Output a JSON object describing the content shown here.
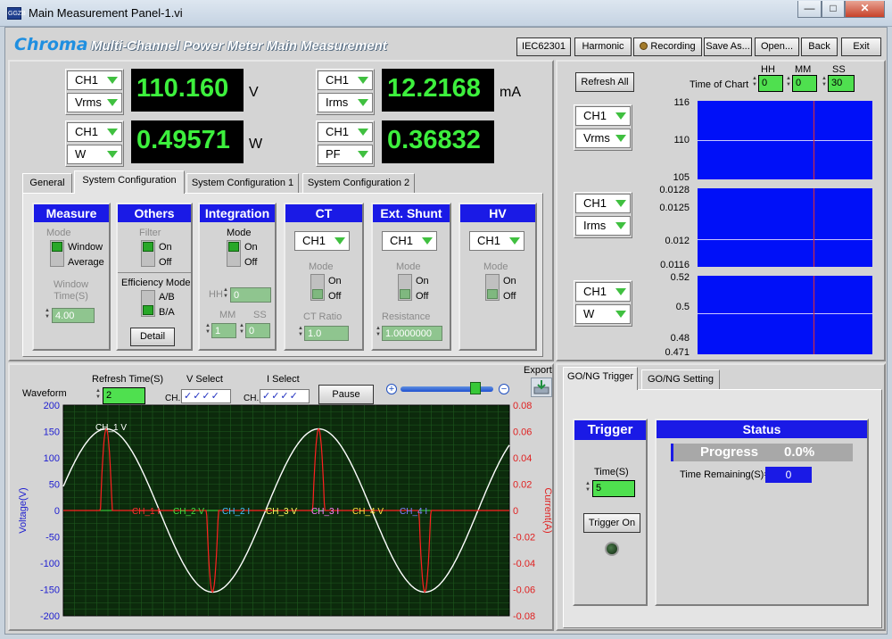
{
  "window": {
    "title": "Main Measurement Panel-1.vi",
    "icon_text": "GGZB",
    "minimize": "—",
    "maximize": "□",
    "close": "✕"
  },
  "header": {
    "logo": "Chroma",
    "title": "Multi-Channel Power Meter Main Measurement",
    "buttons": [
      "IEC62301",
      "Harmonic",
      "Recording",
      "Save As...",
      "Open...",
      "Back",
      "Exit"
    ]
  },
  "measurements": [
    {
      "channel": "CH1",
      "param": "Vrms",
      "value": "110.160",
      "unit": "V"
    },
    {
      "channel": "CH1",
      "param": "Irms",
      "value": "12.2168",
      "unit": "mA"
    },
    {
      "channel": "CH1",
      "param": "W",
      "value": "0.49571",
      "unit": "W"
    },
    {
      "channel": "CH1",
      "param": "PF",
      "value": "0.36832",
      "unit": ""
    }
  ],
  "tabs": [
    "General",
    "System Configuration",
    "System Configuration 1",
    "System Configuration 2"
  ],
  "active_tab": "System Configuration",
  "config": {
    "measure": {
      "title": "Measure",
      "mode_label": "Mode",
      "opt1": "Window",
      "opt2": "Average",
      "time_label": "Window\nTime(S)",
      "time_value": "4.00"
    },
    "others": {
      "title": "Others",
      "filter_label": "Filter",
      "on": "On",
      "off": "Off",
      "eff_label": "Efficiency Mode",
      "ab": "A/B",
      "ba": "B/A",
      "detail": "Detail"
    },
    "integration": {
      "title": "Integration",
      "mode_label": "Mode",
      "on": "On",
      "off": "Off",
      "hh_label": "HH",
      "hh_value": "0",
      "mm_label": "MM",
      "mm_value": "1",
      "ss_label": "SS",
      "ss_value": "0"
    },
    "ct": {
      "title": "CT",
      "channel": "CH1",
      "mode_label": "Mode",
      "on": "On",
      "off": "Off",
      "ratio_label": "CT Ratio",
      "ratio_value": "1.0"
    },
    "ext_shunt": {
      "title": "Ext. Shunt",
      "channel": "CH1",
      "mode_label": "Mode",
      "on": "On",
      "off": "Off",
      "res_label": "Resistance",
      "res_value": "1.0000000"
    },
    "hv": {
      "title": "HV",
      "channel": "CH1",
      "mode_label": "Mode",
      "on": "On",
      "off": "Off"
    }
  },
  "trend": {
    "refresh_all": "Refresh All",
    "time_of_chart_label": "Time of Chart",
    "hh_label": "HH",
    "hh_value": "0",
    "mm_label": "MM",
    "mm_value": "0",
    "ss_label": "SS",
    "ss_value": "30",
    "charts": [
      {
        "channel": "CH1",
        "param": "Vrms",
        "ticks": [
          "116",
          "110",
          "105"
        ],
        "ymin": 105,
        "ymax": 116
      },
      {
        "channel": "CH1",
        "param": "Irms",
        "ticks": [
          "0.0128",
          "0.0125",
          "0.012",
          "0.0116"
        ],
        "ymin": 0.0116,
        "ymax": 0.0128
      },
      {
        "channel": "CH1",
        "param": "W",
        "ticks": [
          "0.52",
          "0.5",
          "0.48",
          "0.471"
        ],
        "ymin": 0.471,
        "ymax": 0.52
      }
    ]
  },
  "waveform": {
    "label": "Waveform",
    "refresh_label": "Refresh Time(S)",
    "refresh_value": "2",
    "vselect_label": "V Select",
    "iselect_label": "I Select",
    "ch_label": "CH.",
    "pause": "Pause",
    "export": "Export",
    "slider_value": 0.85
  },
  "chart_data": {
    "type": "line",
    "ylabel": "Voltage(V)",
    "y2label": "Current(A)",
    "ylim": [
      -200,
      200
    ],
    "y2lim": [
      -0.08,
      0.08
    ],
    "yticks": [
      "200",
      "150",
      "100",
      "50",
      "0",
      "-50",
      "-100",
      "-150",
      "-200"
    ],
    "y2ticks": [
      "0.08",
      "0.06",
      "0.04",
      "0.02",
      "0",
      "-0.02",
      "-0.04",
      "-0.06",
      "-0.08"
    ],
    "grid": true,
    "series_labels": [
      "CH_1 V",
      "CH_1 I",
      "CH_2 V",
      "CH_2 I",
      "CH_3 V",
      "CH_3 I",
      "CH_4 V",
      "CH_4 I"
    ],
    "voltage": {
      "name": "CH_1 V",
      "amplitude": 155,
      "cycles": 2.1,
      "color": "#ffffff"
    },
    "current": {
      "name": "CH_1 I",
      "peak": 0.062,
      "color": "#ff2020"
    }
  },
  "gong": {
    "tabs": [
      "GO/NG Trigger",
      "GO/NG Setting"
    ],
    "trigger_title": "Trigger",
    "time_label": "Time(S)",
    "time_value": "5",
    "trigger_on": "Trigger On",
    "status_title": "Status",
    "progress_label": "Progress",
    "progress_value": "0.0%",
    "remaining_label": "Time Remaining(S)=",
    "remaining_value": "0"
  }
}
